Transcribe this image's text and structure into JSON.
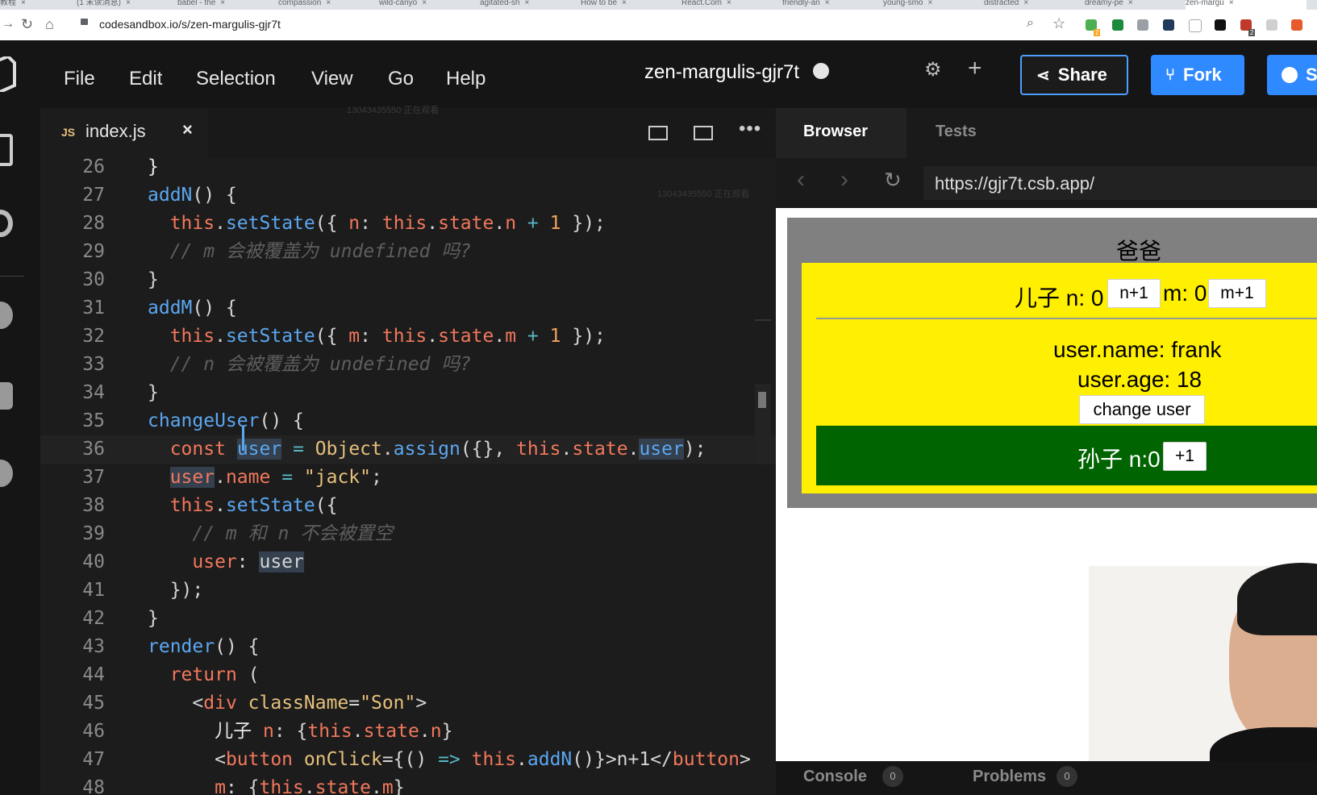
{
  "browser": {
    "tabs": [
      {
        "label": "教程"
      },
      {
        "label": "(1 未读消息)"
      },
      {
        "label": "babel - the"
      },
      {
        "label": "compassion"
      },
      {
        "label": "wild-canyo"
      },
      {
        "label": "agitated-sh"
      },
      {
        "label": "How to be"
      },
      {
        "label": "React.Com"
      },
      {
        "label": "friendly-an"
      },
      {
        "label": "young-smo"
      },
      {
        "label": "distracted"
      },
      {
        "label": "dreamy-pe"
      },
      {
        "label": "zen-margu"
      }
    ],
    "url": "codesandbox.io/s/zen-margulis-gjr7t",
    "extension_badges": [
      "2",
      "2"
    ]
  },
  "menu": [
    "File",
    "Edit",
    "Selection",
    "View",
    "Go",
    "Help"
  ],
  "sandbox": {
    "name": "zen-margulis-gjr7t",
    "share_label": "Share",
    "fork_label": "Fork",
    "signin_label": "S",
    "watch_watermark": "13043435550 正在观看"
  },
  "editor": {
    "tab_label": "index.js",
    "tab_icon": "JS",
    "lines": [
      {
        "n": "26",
        "html": "<span class=\"kw\">}</span>"
      },
      {
        "n": "27",
        "html": "<span class=\"fn\">addN</span>() {"
      },
      {
        "n": "28",
        "html": "  <span class=\"th\">this</span>.<span class=\"fn\">setState</span>({ <span class=\"pl\">n</span>: <span class=\"th\">this</span>.<span class=\"pl\">state</span>.<span class=\"pl\">n</span> <span class=\"op\">+</span> <span class=\"num\">1</span> });"
      },
      {
        "n": "29",
        "html": "  <span class=\"cm\">// m 会被覆盖为 undefined 吗?</span>"
      },
      {
        "n": "30",
        "html": "}"
      },
      {
        "n": "31",
        "html": "<span class=\"fn\">addM</span>() {"
      },
      {
        "n": "32",
        "html": "  <span class=\"th\">this</span>.<span class=\"fn\">setState</span>({ <span class=\"pl\">m</span>: <span class=\"th\">this</span>.<span class=\"pl\">state</span>.<span class=\"pl\">m</span> <span class=\"op\">+</span> <span class=\"num\">1</span> });"
      },
      {
        "n": "33",
        "html": "  <span class=\"cm\">// n 会被覆盖为 undefined 吗?</span>"
      },
      {
        "n": "34",
        "html": "}"
      },
      {
        "n": "35",
        "html": "<span class=\"fn\">changeUser</span>() {"
      },
      {
        "n": "36",
        "html": "  <span class=\"th\">const</span> <span class=\"hl fn\">user</span> <span class=\"op\">=</span> <span class=\"str\">Object</span>.<span class=\"fn\">assign</span>({}, <span class=\"th\">this</span>.<span class=\"pl\">state</span>.<span class=\"hl fn\">user</span>);"
      },
      {
        "n": "37",
        "html": "  <span class=\"hl pl\">user</span>.<span class=\"pl\">name</span> <span class=\"op\">=</span> <span class=\"str\">\"jack\"</span>;"
      },
      {
        "n": "38",
        "html": "  <span class=\"th\">this</span>.<span class=\"fn\">setState</span>({"
      },
      {
        "n": "39",
        "html": "    <span class=\"cm\">// m 和 n 不会被置空</span>"
      },
      {
        "n": "40",
        "html": "    <span class=\"pl\">user</span>: <span class=\"hl\">user</span>"
      },
      {
        "n": "41",
        "html": "  });"
      },
      {
        "n": "42",
        "html": "}"
      },
      {
        "n": "43",
        "html": "<span class=\"fn\">render</span>() {"
      },
      {
        "n": "44",
        "html": "  <span class=\"th\">return</span> ("
      },
      {
        "n": "45",
        "html": "    &lt;<span class=\"th\">div</span> <span class=\"str\">className</span>=<span class=\"str\">\"Son\"</span>&gt;"
      },
      {
        "n": "46",
        "html": "      <span class=\"kw\">儿子</span> <span class=\"pl\">n</span>: {<span class=\"th\">this</span>.<span class=\"pl\">state</span>.<span class=\"pl\">n</span>}"
      },
      {
        "n": "47",
        "html": "      &lt;<span class=\"th\">button</span> <span class=\"str\">onClick</span>={() <span class=\"op\">=&gt;</span> <span class=\"th\">this</span>.<span class=\"fn\">addN</span>()}&gt;n+1&lt;/<span class=\"th\">button</span>&gt;"
      },
      {
        "n": "48",
        "html": "      <span class=\"pl\">m</span>: {<span class=\"th\">this</span>.<span class=\"pl\">state</span>.<span class=\"pl\">m</span>}"
      }
    ]
  },
  "preview": {
    "tabs": [
      "Browser",
      "Tests"
    ],
    "url": "https://gjr7t.csb.app/",
    "app": {
      "dad_title": "爸爸",
      "son_text": "儿子 n: 0",
      "n_btn": "n+1",
      "m_text": "m: 0",
      "m_btn": "m+1",
      "user_name": "user.name: frank",
      "user_age": "user.age: 18",
      "change_btn": "change user",
      "grandson_text": "孙子 n:0",
      "plus_btn": "+1"
    },
    "bottom": {
      "console": "Console",
      "console_count": "0",
      "problems": "Problems",
      "problems_count": "0"
    }
  },
  "colors": {
    "share_border": "#4d9fff",
    "fork_bg": "#2f89ff",
    "yellow": "#ffef00",
    "green": "#006400",
    "grey": "#808080"
  }
}
